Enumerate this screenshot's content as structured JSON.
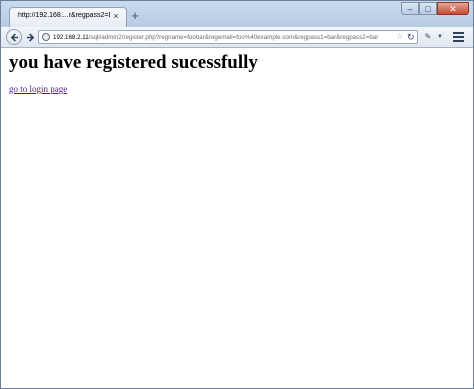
{
  "browser": {
    "tab_title": "http://192.168....r&regpass2=bar",
    "tab_close": "×",
    "new_tab": "+",
    "window_controls": {
      "minimize": "–",
      "maximize": "□",
      "close": "✕"
    },
    "address": {
      "host": "192.168.2.11",
      "path": "/sqli/admin2/register.php?regname=foobar&regemail=foo%40example.com&regpass1=bar&regpass2=bar"
    },
    "icons": {
      "back": "back-arrow-icon",
      "forward": "forward-arrow-icon",
      "page": "globe-icon",
      "bookmark": "star-icon",
      "reload": "reload-icon",
      "addon": "addon-icon",
      "menu": "hamburger-menu-icon"
    }
  },
  "page": {
    "heading": "you have registered sucessfully",
    "link": "go to login page",
    "link_color": "#551a8b"
  }
}
